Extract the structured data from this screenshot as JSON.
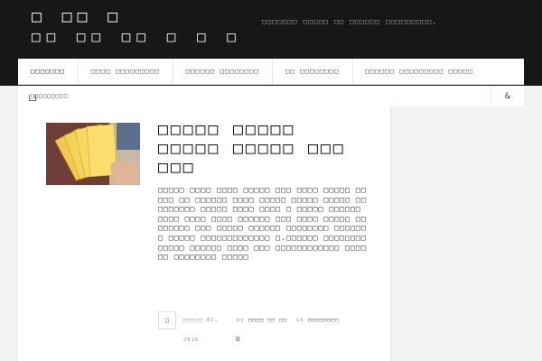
{
  "site": {
    "title_line1": "□ □□ □",
    "title_line2": "□□ □□ □□ □ □ □",
    "tagline": "□□□□□□□ □□□□□ □□ □□□□□□ □□□□□□□□□,"
  },
  "nav": {
    "items": [
      {
        "label": "□□□□□□□"
      },
      {
        "label": "□□□□ □□□□□□□□□"
      },
      {
        "label": "□□□□□□ □□□□□□□□"
      },
      {
        "label": "□□ □□□□□□□□"
      },
      {
        "label": "□□□□□□ □□□□□□□□□ □□□□□"
      }
    ]
  },
  "breadcrumb": {
    "label": "□□□□□□□□□"
  },
  "search": {
    "icon": "search-icon",
    "glyph": "&"
  },
  "post": {
    "title": "□□□□□ □□□□□ □□□□□ □□□□□ □□□ □□□",
    "excerpt": "□□□□□ □□□□ □□□□ □□□□□ □□□ □□□□ □□□□□ □□□□□ □□ □□□□□□ □□□□ □□□□□ □□□□□ □□□□□ □□□□□□□□□ □□□□□ □□□□ □□□□ □ □□□□□ □□□□□□ □□□□ □□□□ □□□□ □□□□□□ □□□ □□□□ □□□□□ □□□□□□□□ □□□ □□□□□ □□□□□□ □□□□□□□□ □□□□□□□ □□□□□ □□□□□□□□□□□□□ □.□□□□□□ □□□□□□□□□□□□□ □□□□□□ □□□□ □□□ □□□□□□□□□□□□ □□□□□□ □□□□□□□□ □□□□□",
    "date": "□□□□□ 01,",
    "year": "2016",
    "by_label": "by",
    "author": "□□□□ □□ □□",
    "in_label": "in",
    "category": "□□□□□□□□",
    "format_glyph": "▯",
    "comment_glyph": "0"
  },
  "colors": {
    "header_bg": "#171717",
    "page_bg": "#f3f3f3",
    "panel_bg": "#ffffff",
    "text": "#111111",
    "meta": "#8a8a8a",
    "accent": "#b33333"
  }
}
